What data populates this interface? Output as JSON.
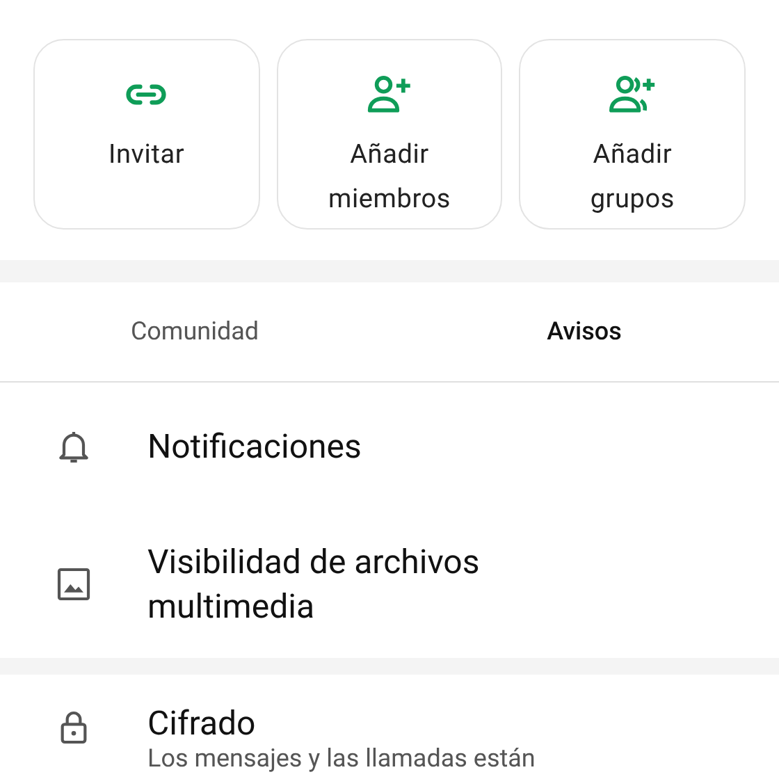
{
  "actions": [
    {
      "kind": "link",
      "label": "Invitar"
    },
    {
      "kind": "add-person",
      "label": "Añadir miembros"
    },
    {
      "kind": "add-group",
      "label": "Añadir grupos"
    }
  ],
  "tabs": [
    {
      "label": "Comunidad",
      "selected": false
    },
    {
      "label": "Avisos",
      "selected": true
    }
  ],
  "settings": [
    {
      "kind": "bell",
      "title": "Notificaciones"
    },
    {
      "kind": "image",
      "title": "Visibilidad de archivos multimedia"
    }
  ],
  "encryption": {
    "kind": "lock",
    "title": "Cifrado",
    "subtitle": "Los mensajes y las llamadas están"
  }
}
